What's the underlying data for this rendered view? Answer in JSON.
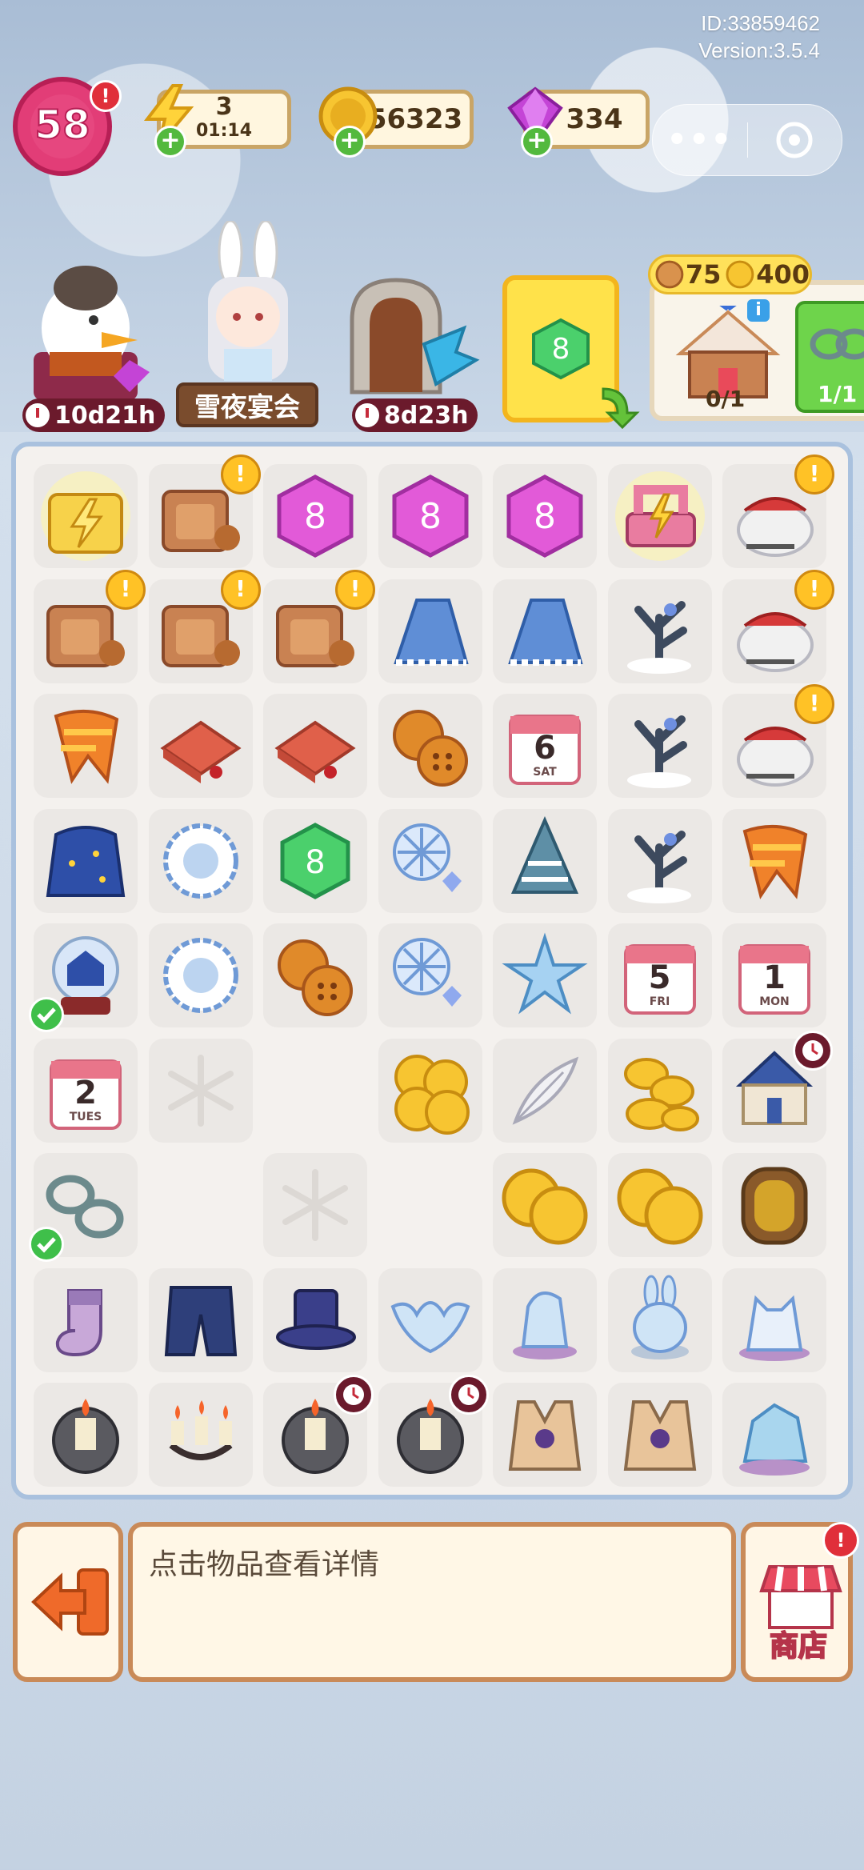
{
  "meta": {
    "id": "ID:33859462",
    "version": "Version:3.5.4"
  },
  "level": {
    "value": "58",
    "alert": "!"
  },
  "resources": {
    "energy": {
      "value": "3",
      "timer": "01:14"
    },
    "coins": {
      "value": "56323"
    },
    "gems": {
      "value": "334"
    },
    "plus": "+"
  },
  "capsule": {
    "more": "•••"
  },
  "events": {
    "duck_timer": "10d21h",
    "bunny_label": "雪夜宴会",
    "door_timer": "8d23h"
  },
  "rewards_panel": {
    "cost_a": "75",
    "cost_b": "400",
    "gingerbread_progress": "0/1",
    "handcuffs_progress": "1/1",
    "info": "i"
  },
  "board": {
    "rows": [
      [
        "energy-chest-glow",
        "cookie-bag-alert",
        "pink-gem",
        "pink-gem",
        "pink-gem",
        "sewing-machine-glow",
        "santa-sack-alert"
      ],
      [
        "cookie-bag-alert",
        "cookie-bag-alert",
        "cookie-bag-alert",
        "blue-cloth",
        "blue-cloth",
        "snowy-tree",
        "santa-sack-alert"
      ],
      [
        "orange-scarf",
        "red-gift-box",
        "red-gift-box",
        "buttons",
        "calendar-6-sat",
        "snowy-tree",
        "santa-sack-alert"
      ],
      [
        "starry-cloak",
        "snowflake-doily",
        "green-gem",
        "snowflakes",
        "snowy-pine",
        "snowy-tree",
        "orange-scarf"
      ],
      [
        "snow-globe-check",
        "snowflake-doily",
        "buttons",
        "snowflakes",
        "ice-star",
        "calendar-5-fri",
        "calendar-1-mon"
      ],
      [
        "calendar-2-tues",
        "locked-snow",
        "empty",
        "coins-pile",
        "feather",
        "coins-stack",
        "winter-mansion-timer"
      ],
      [
        "handcuffs-check",
        "empty",
        "locked-snow",
        "empty",
        "coins-big",
        "coins-big",
        "mirror-portal"
      ],
      [
        "sock",
        "pants",
        "top-hat",
        "ice-bat",
        "ice-horse",
        "ice-bunny",
        "ice-wolf"
      ],
      [
        "candle-lamp",
        "candle-chandelier",
        "candle-lamp-timer",
        "candle-lamp-timer",
        "vest",
        "vest",
        "ice-crystal-wolf"
      ]
    ],
    "calendar_labels": {
      "sat": "6",
      "sat_day": "SAT",
      "fri": "5",
      "fri_day": "FRI",
      "mon": "1",
      "mon_day": "MON",
      "tues": "2",
      "tues_day": "TUES"
    }
  },
  "bottom": {
    "description": "点击物品查看详情",
    "shop_label": "商店",
    "shop_alert": "!"
  },
  "colors": {
    "accent_pink": "#e23d77",
    "board_border": "#a9c1de",
    "panel_border": "#c98a58",
    "alert_red": "#e02f3a",
    "plus_green": "#53b93e"
  }
}
